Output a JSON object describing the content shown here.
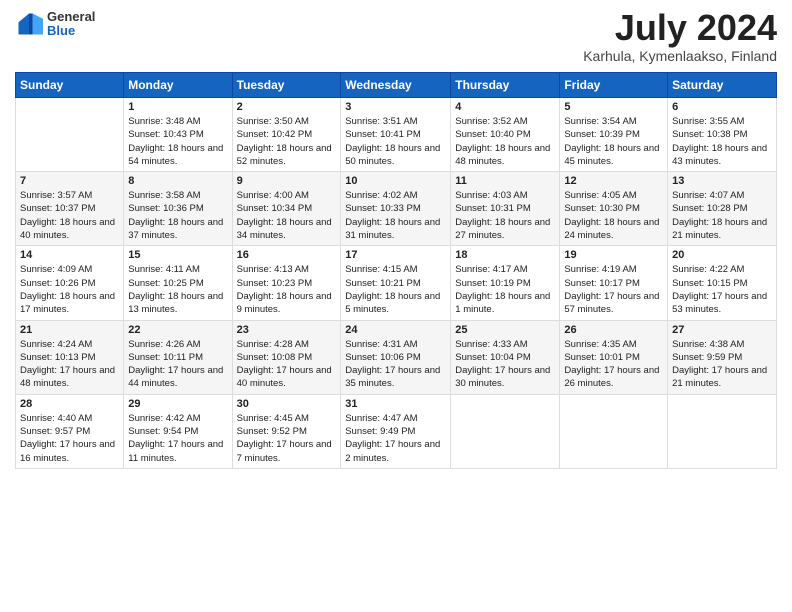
{
  "header": {
    "logo": {
      "line1": "General",
      "line2": "Blue"
    },
    "title": "July 2024",
    "location": "Karhula, Kymenlaakso, Finland"
  },
  "weekdays": [
    "Sunday",
    "Monday",
    "Tuesday",
    "Wednesday",
    "Thursday",
    "Friday",
    "Saturday"
  ],
  "weeks": [
    [
      {
        "day": "",
        "sunrise": "",
        "sunset": "",
        "daylight": ""
      },
      {
        "day": "1",
        "sunrise": "Sunrise: 3:48 AM",
        "sunset": "Sunset: 10:43 PM",
        "daylight": "Daylight: 18 hours and 54 minutes."
      },
      {
        "day": "2",
        "sunrise": "Sunrise: 3:50 AM",
        "sunset": "Sunset: 10:42 PM",
        "daylight": "Daylight: 18 hours and 52 minutes."
      },
      {
        "day": "3",
        "sunrise": "Sunrise: 3:51 AM",
        "sunset": "Sunset: 10:41 PM",
        "daylight": "Daylight: 18 hours and 50 minutes."
      },
      {
        "day": "4",
        "sunrise": "Sunrise: 3:52 AM",
        "sunset": "Sunset: 10:40 PM",
        "daylight": "Daylight: 18 hours and 48 minutes."
      },
      {
        "day": "5",
        "sunrise": "Sunrise: 3:54 AM",
        "sunset": "Sunset: 10:39 PM",
        "daylight": "Daylight: 18 hours and 45 minutes."
      },
      {
        "day": "6",
        "sunrise": "Sunrise: 3:55 AM",
        "sunset": "Sunset: 10:38 PM",
        "daylight": "Daylight: 18 hours and 43 minutes."
      }
    ],
    [
      {
        "day": "7",
        "sunrise": "Sunrise: 3:57 AM",
        "sunset": "Sunset: 10:37 PM",
        "daylight": "Daylight: 18 hours and 40 minutes."
      },
      {
        "day": "8",
        "sunrise": "Sunrise: 3:58 AM",
        "sunset": "Sunset: 10:36 PM",
        "daylight": "Daylight: 18 hours and 37 minutes."
      },
      {
        "day": "9",
        "sunrise": "Sunrise: 4:00 AM",
        "sunset": "Sunset: 10:34 PM",
        "daylight": "Daylight: 18 hours and 34 minutes."
      },
      {
        "day": "10",
        "sunrise": "Sunrise: 4:02 AM",
        "sunset": "Sunset: 10:33 PM",
        "daylight": "Daylight: 18 hours and 31 minutes."
      },
      {
        "day": "11",
        "sunrise": "Sunrise: 4:03 AM",
        "sunset": "Sunset: 10:31 PM",
        "daylight": "Daylight: 18 hours and 27 minutes."
      },
      {
        "day": "12",
        "sunrise": "Sunrise: 4:05 AM",
        "sunset": "Sunset: 10:30 PM",
        "daylight": "Daylight: 18 hours and 24 minutes."
      },
      {
        "day": "13",
        "sunrise": "Sunrise: 4:07 AM",
        "sunset": "Sunset: 10:28 PM",
        "daylight": "Daylight: 18 hours and 21 minutes."
      }
    ],
    [
      {
        "day": "14",
        "sunrise": "Sunrise: 4:09 AM",
        "sunset": "Sunset: 10:26 PM",
        "daylight": "Daylight: 18 hours and 17 minutes."
      },
      {
        "day": "15",
        "sunrise": "Sunrise: 4:11 AM",
        "sunset": "Sunset: 10:25 PM",
        "daylight": "Daylight: 18 hours and 13 minutes."
      },
      {
        "day": "16",
        "sunrise": "Sunrise: 4:13 AM",
        "sunset": "Sunset: 10:23 PM",
        "daylight": "Daylight: 18 hours and 9 minutes."
      },
      {
        "day": "17",
        "sunrise": "Sunrise: 4:15 AM",
        "sunset": "Sunset: 10:21 PM",
        "daylight": "Daylight: 18 hours and 5 minutes."
      },
      {
        "day": "18",
        "sunrise": "Sunrise: 4:17 AM",
        "sunset": "Sunset: 10:19 PM",
        "daylight": "Daylight: 18 hours and 1 minute."
      },
      {
        "day": "19",
        "sunrise": "Sunrise: 4:19 AM",
        "sunset": "Sunset: 10:17 PM",
        "daylight": "Daylight: 17 hours and 57 minutes."
      },
      {
        "day": "20",
        "sunrise": "Sunrise: 4:22 AM",
        "sunset": "Sunset: 10:15 PM",
        "daylight": "Daylight: 17 hours and 53 minutes."
      }
    ],
    [
      {
        "day": "21",
        "sunrise": "Sunrise: 4:24 AM",
        "sunset": "Sunset: 10:13 PM",
        "daylight": "Daylight: 17 hours and 48 minutes."
      },
      {
        "day": "22",
        "sunrise": "Sunrise: 4:26 AM",
        "sunset": "Sunset: 10:11 PM",
        "daylight": "Daylight: 17 hours and 44 minutes."
      },
      {
        "day": "23",
        "sunrise": "Sunrise: 4:28 AM",
        "sunset": "Sunset: 10:08 PM",
        "daylight": "Daylight: 17 hours and 40 minutes."
      },
      {
        "day": "24",
        "sunrise": "Sunrise: 4:31 AM",
        "sunset": "Sunset: 10:06 PM",
        "daylight": "Daylight: 17 hours and 35 minutes."
      },
      {
        "day": "25",
        "sunrise": "Sunrise: 4:33 AM",
        "sunset": "Sunset: 10:04 PM",
        "daylight": "Daylight: 17 hours and 30 minutes."
      },
      {
        "day": "26",
        "sunrise": "Sunrise: 4:35 AM",
        "sunset": "Sunset: 10:01 PM",
        "daylight": "Daylight: 17 hours and 26 minutes."
      },
      {
        "day": "27",
        "sunrise": "Sunrise: 4:38 AM",
        "sunset": "Sunset: 9:59 PM",
        "daylight": "Daylight: 17 hours and 21 minutes."
      }
    ],
    [
      {
        "day": "28",
        "sunrise": "Sunrise: 4:40 AM",
        "sunset": "Sunset: 9:57 PM",
        "daylight": "Daylight: 17 hours and 16 minutes."
      },
      {
        "day": "29",
        "sunrise": "Sunrise: 4:42 AM",
        "sunset": "Sunset: 9:54 PM",
        "daylight": "Daylight: 17 hours and 11 minutes."
      },
      {
        "day": "30",
        "sunrise": "Sunrise: 4:45 AM",
        "sunset": "Sunset: 9:52 PM",
        "daylight": "Daylight: 17 hours and 7 minutes."
      },
      {
        "day": "31",
        "sunrise": "Sunrise: 4:47 AM",
        "sunset": "Sunset: 9:49 PM",
        "daylight": "Daylight: 17 hours and 2 minutes."
      },
      {
        "day": "",
        "sunrise": "",
        "sunset": "",
        "daylight": ""
      },
      {
        "day": "",
        "sunrise": "",
        "sunset": "",
        "daylight": ""
      },
      {
        "day": "",
        "sunrise": "",
        "sunset": "",
        "daylight": ""
      }
    ]
  ]
}
